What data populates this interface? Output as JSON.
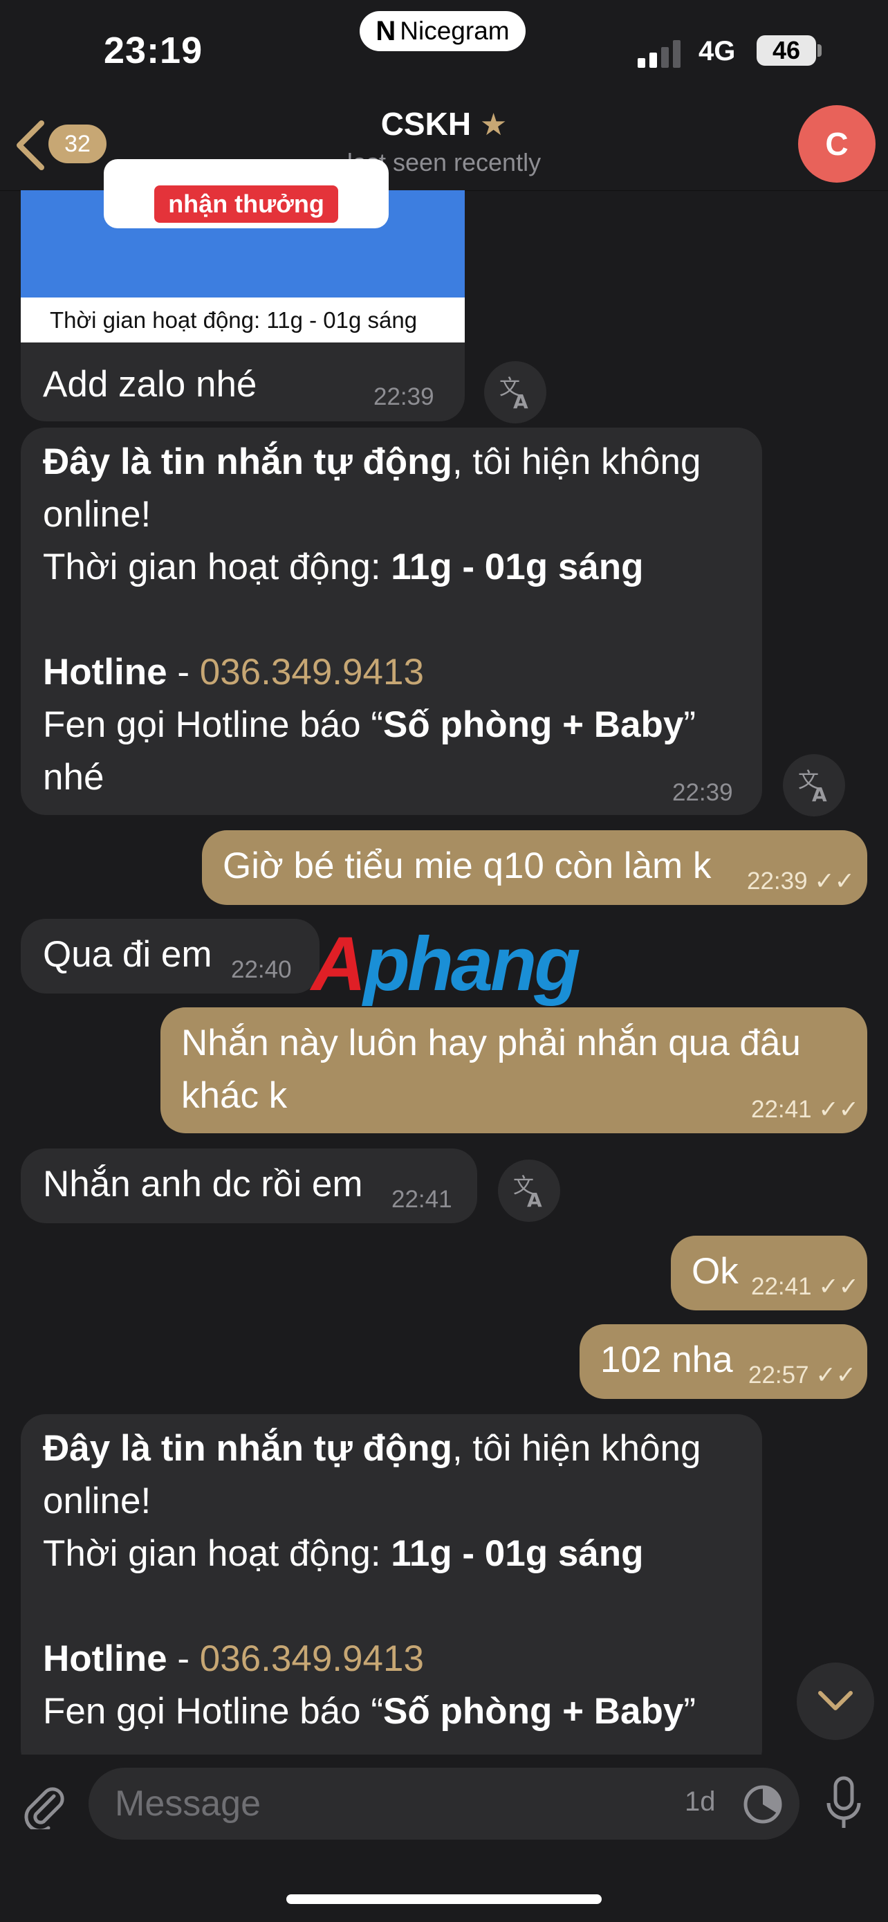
{
  "status": {
    "time": "23:19",
    "app_pill_logo": "N",
    "app_pill_name": "Nicegram",
    "network": "4G",
    "battery": "46"
  },
  "header": {
    "unread_count": "32",
    "title": "CSKH",
    "status": "last seen recently",
    "avatar_letter": "C"
  },
  "messages": {
    "m0": {
      "image_button": "nhận thưởng",
      "image_caption": "Thời gian hoạt động: 11g - 01g sáng",
      "text": "Add zalo nhé",
      "time": "22:39"
    },
    "m1": {
      "l1_bold": "Đây là tin nhắn tự động",
      "l1_rest": ", tôi hiện không",
      "l2": "online!",
      "l3_label": "Thời gian hoạt động: ",
      "l3_bold": "11g - 01g sáng",
      "l5_bold": "Hotline",
      "l5_sep": " - ",
      "l5_phone": "036.349.9413",
      "l6_a": "Fen gọi Hotline báo “",
      "l6_bold": "Số phòng + Baby",
      "l6_b": "”",
      "l7": "nhé",
      "time": "22:39"
    },
    "m2": {
      "text": "Giờ bé tiểu mie q10 còn làm k",
      "time": "22:39"
    },
    "m3": {
      "text": "Qua đi em",
      "time": "22:40"
    },
    "m4": {
      "l1": "Nhắn này luôn hay phải nhắn qua đâu",
      "l2": "khác k",
      "time": "22:41"
    },
    "m5": {
      "text": "Nhắn anh dc rồi em",
      "time": "22:41"
    },
    "m6": {
      "text": "Ok",
      "time": "22:41"
    },
    "m7": {
      "text": "102 nha",
      "time": "22:57"
    },
    "m8": {
      "l1_bold": "Đây là tin nhắn tự động",
      "l1_rest": ", tôi hiện không",
      "l2": "online!",
      "l3_label": "Thời gian hoạt động: ",
      "l3_bold": "11g - 01g sáng",
      "l5_bold": "Hotline",
      "l5_sep": " - ",
      "l5_phone": "036.349.9413",
      "l6_a": "Fen gọi Hotline báo “",
      "l6_bold": "Số phòng + Baby",
      "l6_b": "”"
    }
  },
  "watermark": {
    "part1": "A",
    "part2": "phang"
  },
  "input": {
    "placeholder": "Message",
    "timer_label": "1d"
  },
  "icons": {
    "back": "chevron-left-icon",
    "translate": "translate-icon",
    "read": "double-check-icon",
    "attach": "paperclip-icon",
    "timer": "timer-icon",
    "mic": "microphone-icon",
    "scroll": "chevron-down-icon"
  },
  "colors": {
    "background": "#1b1b1d",
    "incoming": "#2c2c2e",
    "outgoing": "#a88e62",
    "accent": "#c7a774",
    "avatar": "#e8625a"
  }
}
